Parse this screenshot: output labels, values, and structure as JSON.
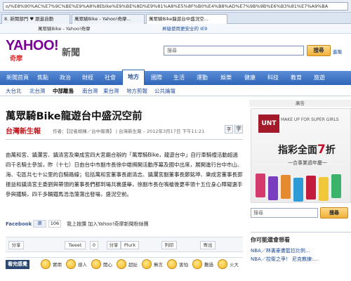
{
  "browser": {
    "url": "o/%E8%90%AC%E7%9C%BE%E9%A8%8Ebike%E9%BE%8D%E9%81%A8%E5%8F%B0%E4%B8%AD%E7%9B%9B%E6%B3%81%E7%A9%BA",
    "tabs": [
      {
        "label": "8. 新聞部門 ♥ 跟進自動"
      },
      {
        "label": "萬眾騎Bike - Yahoo!奇摩..."
      },
      {
        "label": "萬眾騎Bike龍遊台中盛況空..."
      }
    ],
    "favorites": [
      "萬眾騎Bike - Yahoo!奇摩",
      "昇級使用更安全的 IE9"
    ]
  },
  "header": {
    "logo": "YAHOO!",
    "logo_sub": "奇摩",
    "section": "新聞",
    "search_placeholder": "搜尋",
    "search_button": "搜尋",
    "advanced": "進階"
  },
  "nav": {
    "items": [
      "新聞首頁",
      "焦點",
      "政治",
      "財經",
      "社會",
      "地方",
      "國際",
      "生活",
      "運動",
      "娛樂",
      "健康",
      "科技",
      "教育",
      "旅遊"
    ],
    "active_index": 5
  },
  "subnav": {
    "items": [
      "大台北",
      "北台灣",
      "中部離島",
      "南台灣",
      "東台灣",
      "地方剪報",
      "公共論壇"
    ],
    "active_index": 2
  },
  "article": {
    "headline": "萬眾騎Bike龍遊台中盛況空前",
    "source_logo": "台灣新生報",
    "byline": "作者：【記者胡棟／台中報導】 | 台灣新生報 – 2012年3月17日 下午11:21",
    "font_small": "字",
    "font_large": "字",
    "body": "由萬和宮、鎮瀾宮、鎮清宮及樂成宮四大宮廟合辦的「萬眾騎Bike，龍遊台中」自行車騎禮活動超過四千名騎士參加，昨（十七）日由台中市副市長徐中雄揭開活動序幕及國中出席，展開進行台中市山、海、屯區共七十公里的自騎路線；包括萬和宮董事長謝清志、鎮瀾宮副董事長鄭銘坤、樂成宮董事長郭振益和鎮清宮主委劉與帶領的董事長們都到場共襄盛舉，徐副市長在鳴槍後更率領十五位身心障礙選手參與鐵騎，四千多輛鐵馬浩浩蕩蕩出發場，盛況空前。",
    "facebook": {
      "label": "Facebook",
      "like": "讚",
      "count": "106",
      "text": "我上按讚 加入Yahoo!奇摩新聞粉絲團"
    },
    "share": [
      "分享",
      "Tweet",
      "0",
      "分享",
      "Plurk",
      "列印",
      "寄出"
    ],
    "mood": {
      "title": "看完感覺",
      "labels": [
        "實用",
        "感人",
        "開心",
        "超扯",
        "無言",
        "害怕",
        "難過",
        "火大"
      ]
    }
  },
  "sidebar": {
    "ad_label": "廣告",
    "ad": {
      "brand": "UNT",
      "tagline": "MAKE UP FOR SUPER GIRLS",
      "main": "指彩全面",
      "highlight": "7",
      "unit": "折",
      "sub": "一合事業週年慶一"
    },
    "search_placeholder": "搜尋",
    "search_button": "搜尋",
    "like_title": "你可能還會想看",
    "like_items": [
      "NBA／林書豪畫籃拉比例...",
      "NBA／控衛之爭！ 尼克教練:..."
    ]
  },
  "colors": {
    "nav_blue": "#2f64b8",
    "yahoo_purple": "#7b0099",
    "accent_red": "#c40e2a"
  }
}
